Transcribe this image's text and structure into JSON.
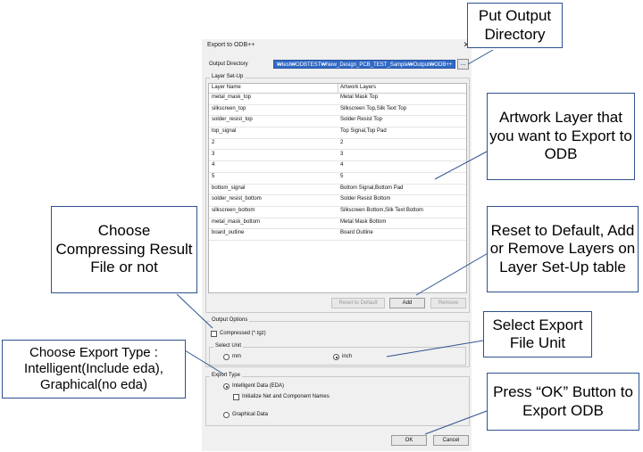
{
  "dialog": {
    "title": "Export to ODB++",
    "close_glyph": "✕",
    "output_directory_label": "Output Directory",
    "output_directory_value": "₩test₩ODBTEST₩New_Design_PCB_TEST_Sample₩Output₩ODB++",
    "browse_label": "...",
    "layer_setup": {
      "title": "Layer Set-Up",
      "columns": [
        "Layer Name",
        "Artwork Layers"
      ],
      "rows": [
        [
          "metal_mask_top",
          "Metal Mask Top"
        ],
        [
          "silkscreen_top",
          "Silkscreen Top,Silk Text Top"
        ],
        [
          "solder_resist_top",
          "Solder Resist Top"
        ],
        [
          "top_signal",
          "Top Signal,Top Pad"
        ],
        [
          "2",
          "2"
        ],
        [
          "3",
          "3"
        ],
        [
          "4",
          "4"
        ],
        [
          "5",
          "5"
        ],
        [
          "bottom_signal",
          "Bottom Signal,Bottom Pad"
        ],
        [
          "solder_resist_bottom",
          "Solder Resist Bottom"
        ],
        [
          "silkscreen_bottom",
          "Silkscreen Bottom,Silk Text Bottom"
        ],
        [
          "metal_mask_bottom",
          "Metal Mask Bottom"
        ],
        [
          "board_outline",
          "Board Outline"
        ]
      ],
      "reset_label": "Reset to Default",
      "add_label": "Add",
      "remove_label": "Remove"
    },
    "output_options": {
      "title": "Output Options",
      "compressed_label": "Compressed (*.tgz)",
      "compressed_checked": false,
      "select_unit_title": "Select Unit",
      "unit_mm": "mm",
      "unit_inch": "inch",
      "selected_unit": "inch"
    },
    "export_type": {
      "title": "Export Type",
      "intelligent_label": "Intelligent Data (EDA)",
      "init_names_label": "Initialize Net and Component Names",
      "graphical_label": "Graphical Data",
      "selected": "intelligent"
    },
    "ok_label": "OK",
    "cancel_label": "Cancel"
  },
  "callouts": {
    "output_dir": "Put Output Directory",
    "artwork": "Artwork Layer that you want to Export to ODB",
    "reset": "Reset to Default, Add or Remove Layers on Layer Set-Up table",
    "compress": "Choose Compressing Result File or not",
    "unit": "Select Export File Unit",
    "export_type": "Choose Export Type : Intelligent(Include eda), Graphical(no eda)",
    "ok": "Press “OK” Button to Export ODB"
  }
}
